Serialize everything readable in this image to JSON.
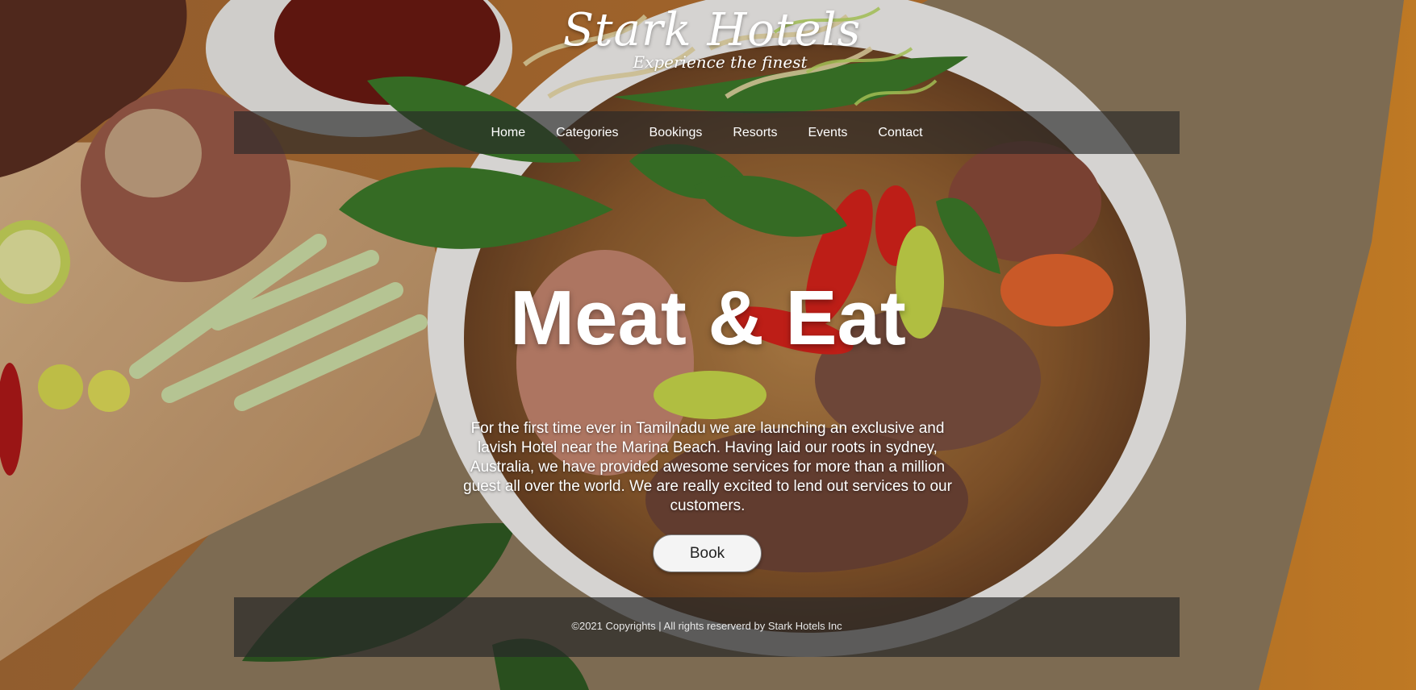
{
  "brand": {
    "title": "Stark Hotels",
    "tagline": "Experience the finest"
  },
  "nav": {
    "items": [
      {
        "label": "Home"
      },
      {
        "label": "Categories"
      },
      {
        "label": "Bookings"
      },
      {
        "label": "Resorts"
      },
      {
        "label": "Events"
      },
      {
        "label": "Contact"
      }
    ]
  },
  "hero": {
    "title": "Meat & Eat",
    "description": "For the first time ever in Tamilnadu we are launching an exclusive and lavish Hotel near the Marina Beach. Having laid our roots in sydney, Australia, we have provided awesome services for more than a million guest all over the world. We are really excited to lend out services to our customers.",
    "book_label": "Book"
  },
  "footer": {
    "copyright": "©2021 Copyrights | All rights reserverd by Stark Hotels Inc"
  },
  "colors": {
    "nav_bg": "#282828",
    "text": "#ffffff",
    "button_bg": "#f4f4f4"
  }
}
